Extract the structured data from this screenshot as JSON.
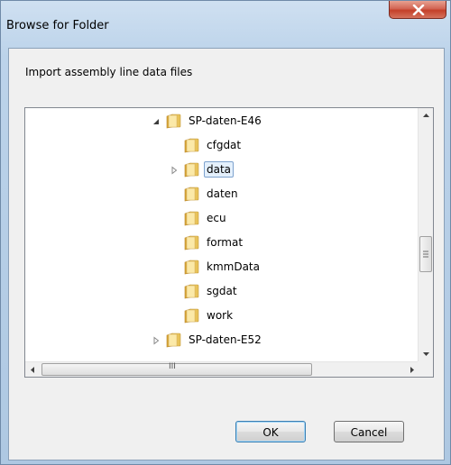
{
  "window": {
    "title": "Browse for Folder",
    "close_glyph": "x"
  },
  "dialog": {
    "instruction": "Import assembly line data files"
  },
  "tree": {
    "items": [
      {
        "label": "SP-daten-E46",
        "level": 0,
        "expander": "expanded",
        "selected": false
      },
      {
        "label": "cfgdat",
        "level": 1,
        "expander": "none",
        "selected": false
      },
      {
        "label": "data",
        "level": 1,
        "expander": "collapsed",
        "selected": true
      },
      {
        "label": "daten",
        "level": 1,
        "expander": "none",
        "selected": false
      },
      {
        "label": "ecu",
        "level": 1,
        "expander": "none",
        "selected": false
      },
      {
        "label": "format",
        "level": 1,
        "expander": "none",
        "selected": false
      },
      {
        "label": "kmmData",
        "level": 1,
        "expander": "none",
        "selected": false
      },
      {
        "label": "sgdat",
        "level": 1,
        "expander": "none",
        "selected": false
      },
      {
        "label": "work",
        "level": 1,
        "expander": "none",
        "selected": false
      },
      {
        "label": "SP-daten-E52",
        "level": 0,
        "expander": "collapsed",
        "selected": false
      }
    ]
  },
  "scrollbars": {
    "hthumb_grip": "III"
  },
  "buttons": {
    "ok": "OK",
    "cancel": "Cancel"
  },
  "colors": {
    "folder": "#e8c35a",
    "selection_bg": "#e4f0fc",
    "close_red": "#c4402a"
  }
}
